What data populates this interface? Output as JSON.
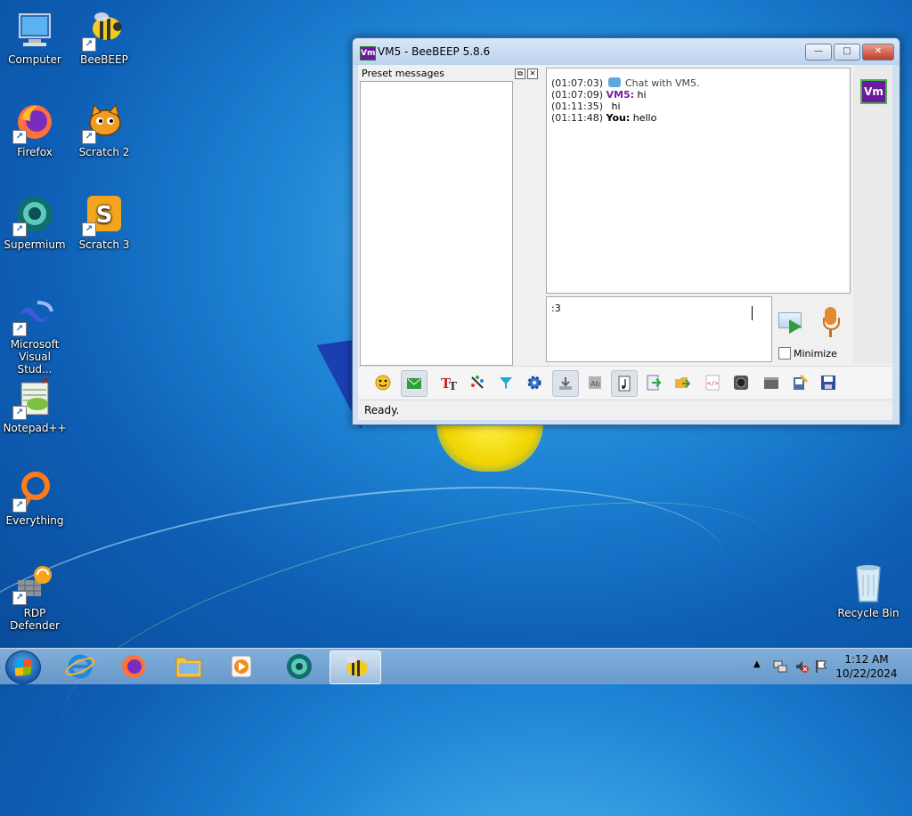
{
  "desktop": {
    "icons": [
      {
        "label": "Computer"
      },
      {
        "label": "BeeBEEP"
      },
      {
        "label": "Firefox"
      },
      {
        "label": "Scratch 2"
      },
      {
        "label": "Supermium"
      },
      {
        "label": "Scratch 3"
      },
      {
        "label": "Microsoft Visual Stud..."
      },
      {
        "label": "Notepad++"
      },
      {
        "label": "Everything"
      },
      {
        "label": "RDP Defender"
      },
      {
        "label": "Recycle Bin"
      }
    ]
  },
  "window": {
    "app_icon": "Vm",
    "title": "VM5 - BeeBEEP 5.8.6",
    "buttons": {
      "minimize": "—",
      "maximize": "□",
      "close": "✕"
    },
    "preset_messages": {
      "title": "Preset messages",
      "float_icon": "⧉",
      "close_icon": "✕"
    },
    "chat": [
      {
        "time": "(01:07:03)",
        "text": "Chat with VM5.",
        "type": "system"
      },
      {
        "time": "(01:07:09)",
        "sender": "VM5:",
        "text": "hi",
        "type": "remote"
      },
      {
        "time": "(01:11:35)",
        "text": "hi",
        "type": "continuation"
      },
      {
        "time": "(01:11:48)",
        "sender": "You:",
        "text": "hello",
        "type": "self"
      }
    ],
    "input": {
      "value": ":3"
    },
    "minimize_label": "Minimize",
    "avatar": "Vm",
    "status": "Ready."
  },
  "toolbar": {
    "buttons": [
      "emoticons-icon",
      "preset-messages-icon",
      "font-icon",
      "font-color-icon",
      "filter-icon",
      "settings-gear-icon",
      "save-chat-icon",
      "clear-chat-icon",
      "notes-icon",
      "send-file-icon",
      "send-folder-icon",
      "html-icon",
      "screenshot-icon",
      "film-icon",
      "edit-icon",
      "save-icon"
    ]
  },
  "taskbar": {
    "apps": [
      "internet-explorer-icon",
      "firefox-icon",
      "file-explorer-icon",
      "media-player-icon",
      "supermium-icon",
      "beebeep-icon"
    ],
    "time": "1:12 AM",
    "date": "10/22/2024"
  },
  "colors": {
    "accent": "#6a1b9a",
    "desktop": "#1f86d6"
  }
}
